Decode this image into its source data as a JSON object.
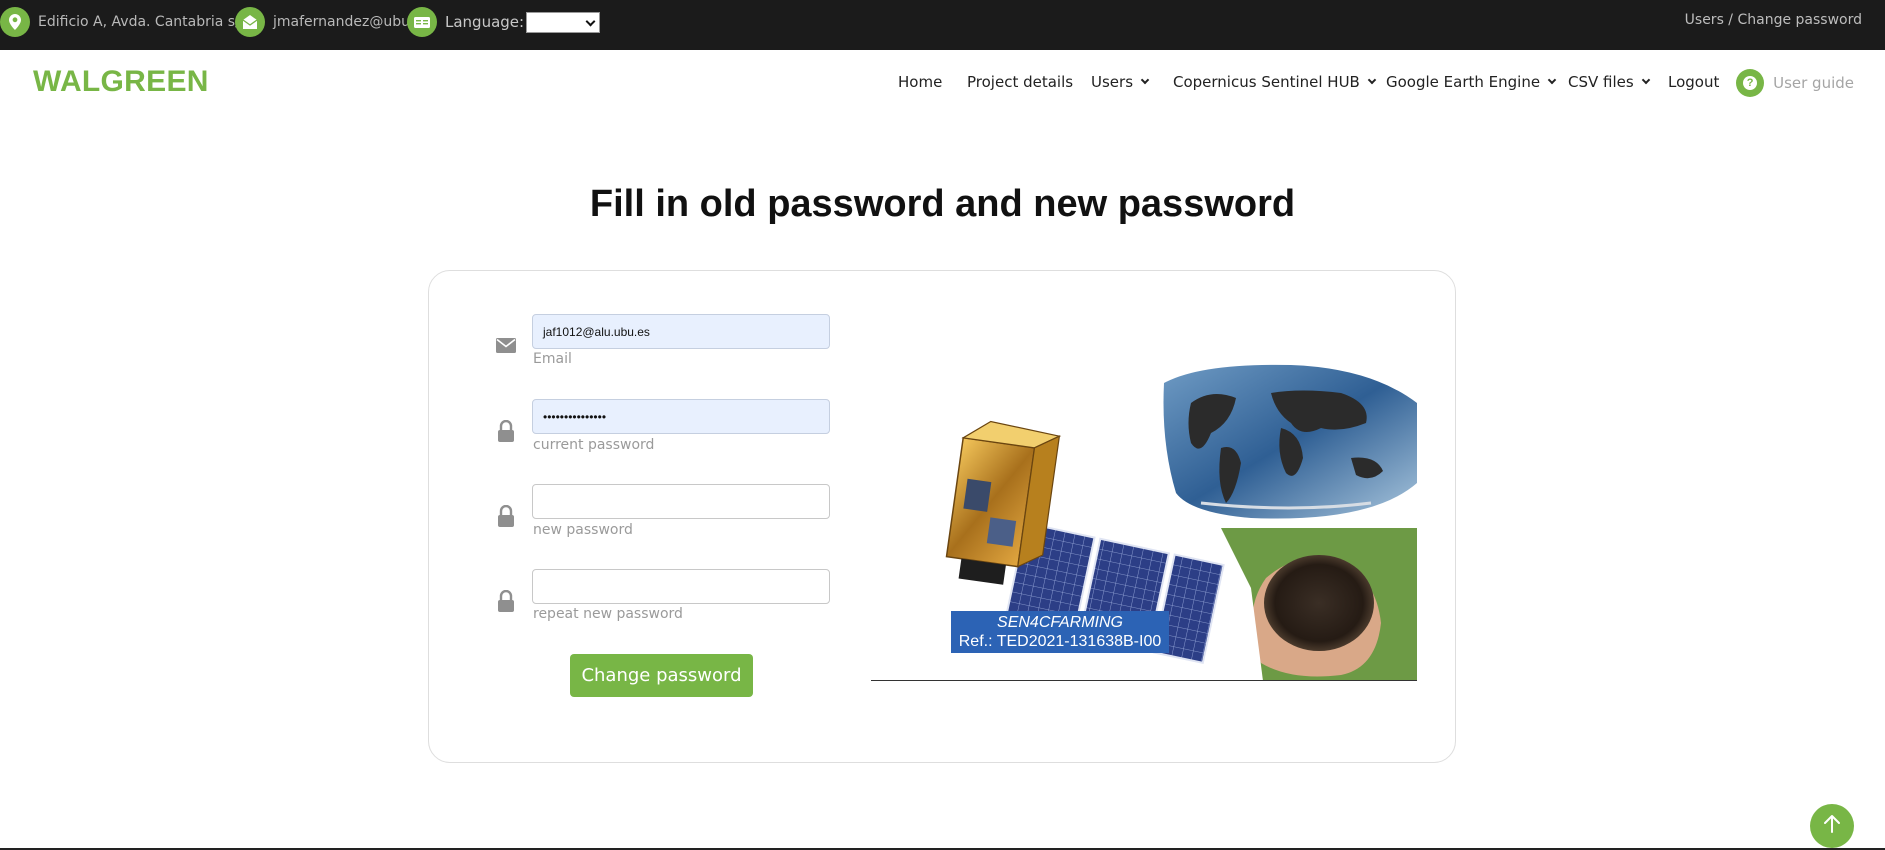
{
  "topbar": {
    "address": "Edificio A, Avda. Cantabria s/n",
    "email": "jmafernandez@ubu.es",
    "language_label": "Language:",
    "language_value": "",
    "breadcrumb": "Users / Change password"
  },
  "nav": {
    "logo": "WALGREEN",
    "items": [
      {
        "label": "Home"
      },
      {
        "label": "Project details"
      },
      {
        "label": "Users"
      },
      {
        "label": "Copernicus Sentinel HUB"
      },
      {
        "label": "Google Earth Engine"
      },
      {
        "label": "CSV files"
      },
      {
        "label": "Logout"
      }
    ],
    "user_guide": "User guide"
  },
  "page": {
    "title": "Fill in old password and new password"
  },
  "form": {
    "email": {
      "value": "jaf1012@alu.ubu.es",
      "label": "Email"
    },
    "current_password": {
      "value": "•••••••••••••••",
      "label": "current password"
    },
    "new_password": {
      "value": "",
      "label": "new password"
    },
    "repeat_password": {
      "value": "",
      "label": "repeat new password"
    },
    "submit_label": "Change password"
  },
  "illustration": {
    "project_name": "SEN4CFARMING",
    "reference": "Ref.: TED2021-131638B-I00"
  },
  "colors": {
    "accent": "#78b646",
    "topbar_bg": "#1b1b1b",
    "autofill_bg": "#e8f0fe",
    "ref_box": "#2c63b5"
  }
}
